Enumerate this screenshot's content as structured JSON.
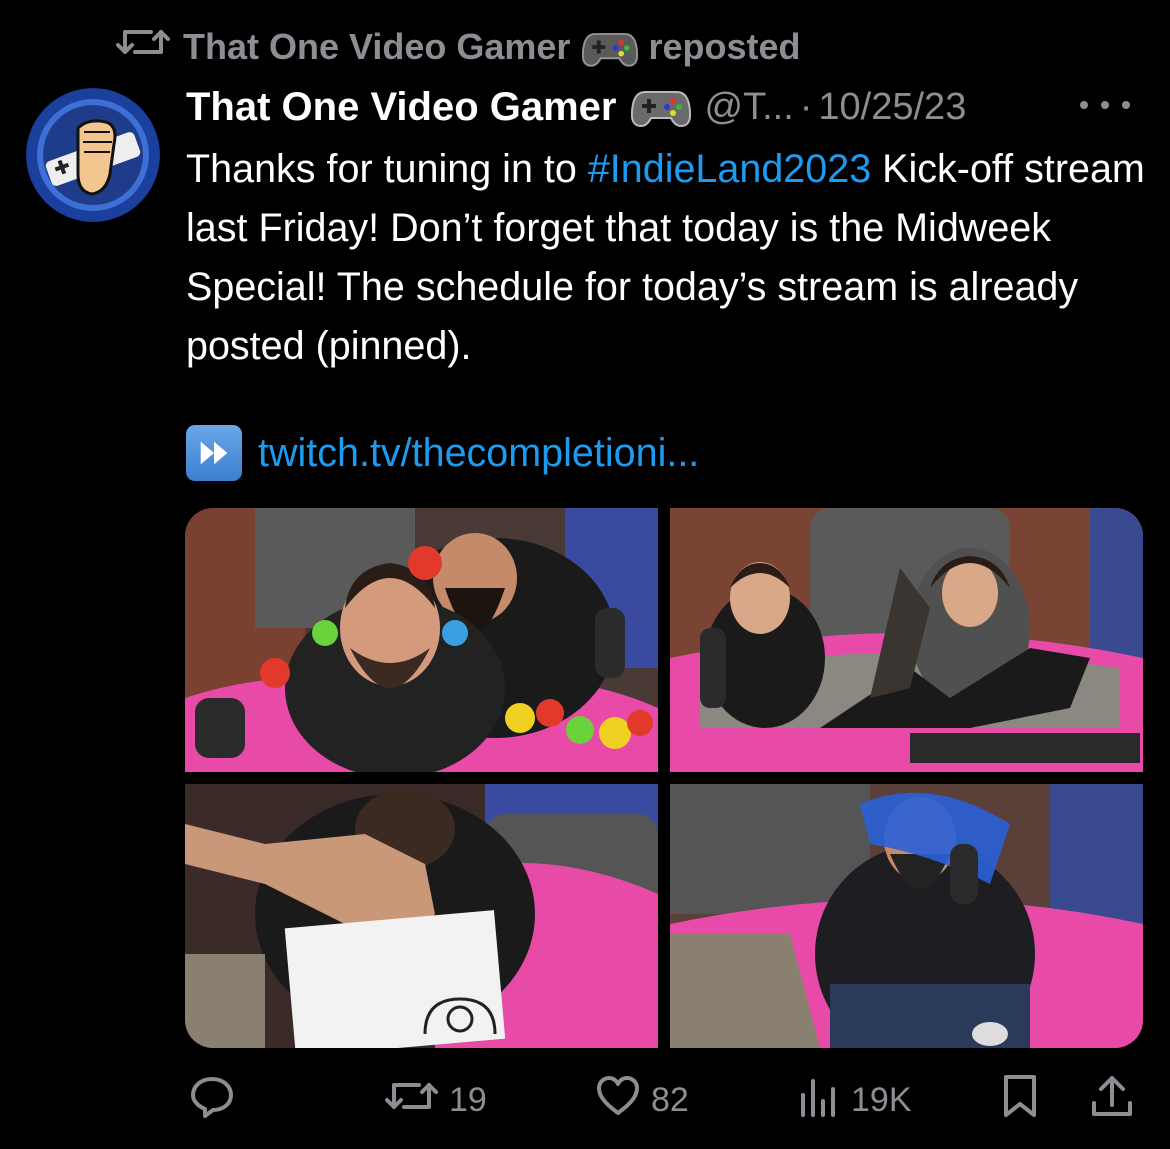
{
  "repost": {
    "reposter_name": "That One Video Gamer",
    "reposted_label": "reposted"
  },
  "tweet": {
    "display_name": "That One Video Gamer",
    "handle": "@T...",
    "separator": "·",
    "date": "10/25/23",
    "text_before_hashtag": "Thanks for tuning in to ",
    "hashtag": "#IndieLand2023",
    "text_after_hashtag": " Kick-off stream last Friday! Don’t forget that today is the Midweek Special! The schedule for today’s stream is already posted (pinned).",
    "link": "twitch.tv/thecompletioni..."
  },
  "actions": {
    "reply_count": "",
    "repost_count": "19",
    "like_count": "82",
    "views_count": "19K"
  },
  "icons": {
    "repost": "repost-icon",
    "gamepad": "gamepad-emoji-icon",
    "fast_forward": "fast-forward-emoji-icon",
    "more": "more-icon",
    "reply": "reply-icon",
    "like": "heart-icon",
    "views": "views-icon",
    "bookmark": "bookmark-icon",
    "share": "share-icon"
  },
  "colors": {
    "background": "#000000",
    "text": "#ffffff",
    "muted": "#8b8f94",
    "link": "#1d9bf0"
  }
}
